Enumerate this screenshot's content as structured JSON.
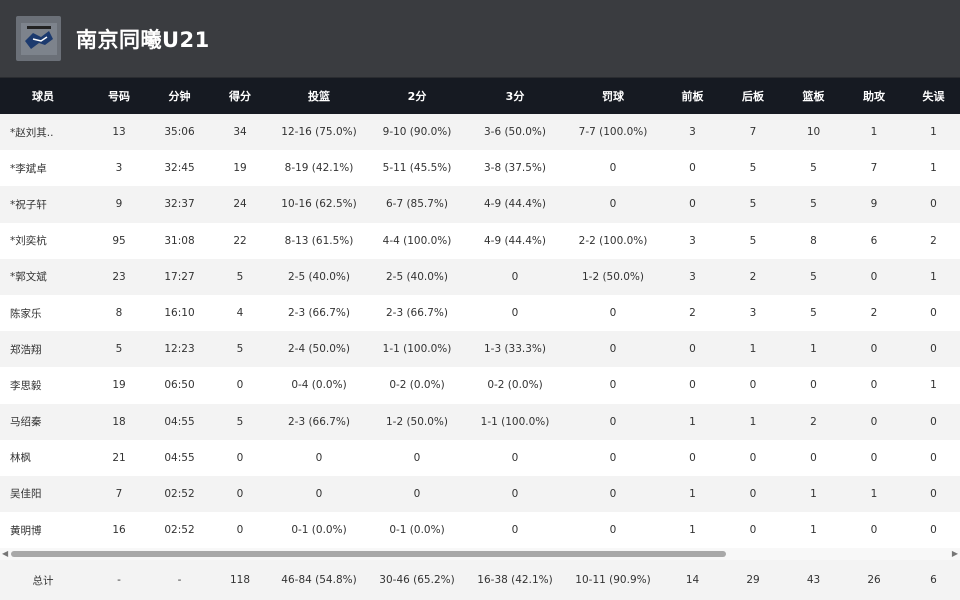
{
  "team": {
    "name": "南京同曦U21",
    "logo_icon": "team-logo-icon"
  },
  "columns": [
    "球员",
    "号码",
    "分钟",
    "得分",
    "投篮",
    "2分",
    "3分",
    "罚球",
    "前板",
    "后板",
    "篮板",
    "助攻",
    "失误"
  ],
  "players": [
    [
      "*赵刘其..",
      "13",
      "35:06",
      "34",
      "12-16 (75.0%)",
      "9-10 (90.0%)",
      "3-6 (50.0%)",
      "7-7 (100.0%)",
      "3",
      "7",
      "10",
      "1",
      "1"
    ],
    [
      "*李斌卓",
      "3",
      "32:45",
      "19",
      "8-19 (42.1%)",
      "5-11 (45.5%)",
      "3-8 (37.5%)",
      "0",
      "0",
      "5",
      "5",
      "7",
      "1"
    ],
    [
      "*祝子轩",
      "9",
      "32:37",
      "24",
      "10-16 (62.5%)",
      "6-7 (85.7%)",
      "4-9 (44.4%)",
      "0",
      "0",
      "5",
      "5",
      "9",
      "0"
    ],
    [
      "*刘奕杭",
      "95",
      "31:08",
      "22",
      "8-13 (61.5%)",
      "4-4 (100.0%)",
      "4-9 (44.4%)",
      "2-2 (100.0%)",
      "3",
      "5",
      "8",
      "6",
      "2"
    ],
    [
      "*郭文斌",
      "23",
      "17:27",
      "5",
      "2-5 (40.0%)",
      "2-5 (40.0%)",
      "0",
      "1-2 (50.0%)",
      "3",
      "2",
      "5",
      "0",
      "1"
    ],
    [
      "陈家乐",
      "8",
      "16:10",
      "4",
      "2-3 (66.7%)",
      "2-3 (66.7%)",
      "0",
      "0",
      "2",
      "3",
      "5",
      "2",
      "0"
    ],
    [
      "郑浩翔",
      "5",
      "12:23",
      "5",
      "2-4 (50.0%)",
      "1-1 (100.0%)",
      "1-3 (33.3%)",
      "0",
      "0",
      "1",
      "1",
      "0",
      "0"
    ],
    [
      "李思毅",
      "19",
      "06:50",
      "0",
      "0-4 (0.0%)",
      "0-2 (0.0%)",
      "0-2 (0.0%)",
      "0",
      "0",
      "0",
      "0",
      "0",
      "1"
    ],
    [
      "马绍秦",
      "18",
      "04:55",
      "5",
      "2-3 (66.7%)",
      "1-2 (50.0%)",
      "1-1 (100.0%)",
      "0",
      "1",
      "1",
      "2",
      "0",
      "0"
    ],
    [
      "林枫",
      "21",
      "04:55",
      "0",
      "0",
      "0",
      "0",
      "0",
      "0",
      "0",
      "0",
      "0",
      "0"
    ],
    [
      "吴佳阳",
      "7",
      "02:52",
      "0",
      "0",
      "0",
      "0",
      "0",
      "1",
      "0",
      "1",
      "1",
      "0"
    ],
    [
      "黄明博",
      "16",
      "02:52",
      "0",
      "0-1 (0.0%)",
      "0-1 (0.0%)",
      "0",
      "0",
      "1",
      "0",
      "1",
      "0",
      "0"
    ]
  ],
  "totals": [
    "总计",
    "-",
    "-",
    "118",
    "46-84 (54.8%)",
    "30-46 (65.2%)",
    "16-38 (42.1%)",
    "10-11 (90.9%)",
    "14",
    "29",
    "43",
    "26",
    "6"
  ],
  "scrollbar": {
    "left_arrow": "◀",
    "right_arrow": "▶"
  },
  "colors": {
    "header_bg": "#3a3c40",
    "table_header_bg": "#161a22",
    "row_alt": "#f3f3f3"
  }
}
